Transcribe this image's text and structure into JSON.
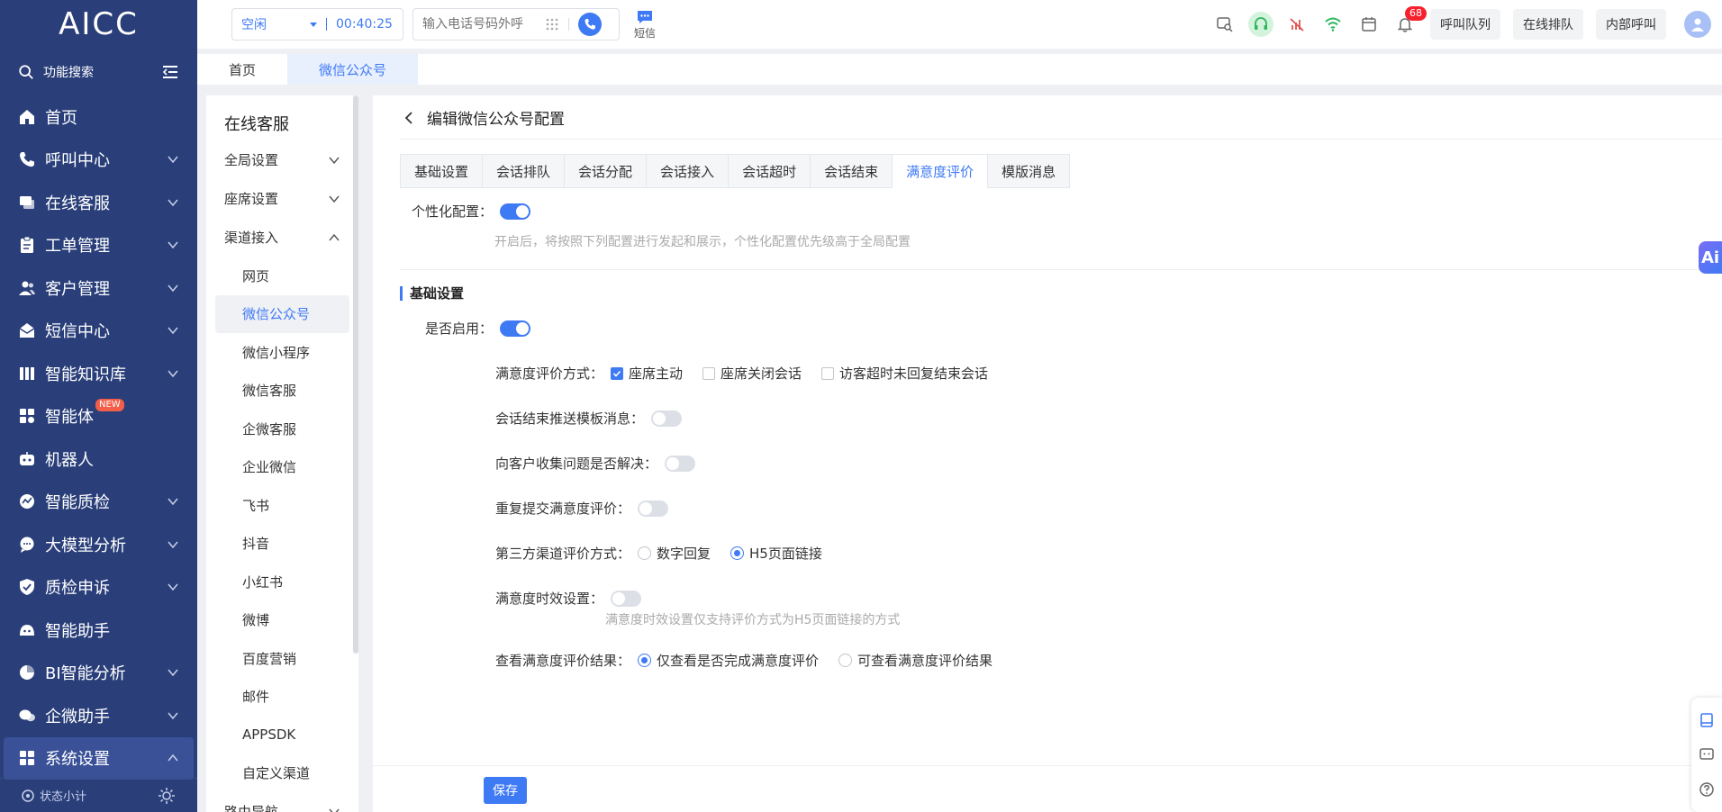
{
  "sidebar": {
    "logo": "AICC",
    "search_label": "功能搜索",
    "items": [
      {
        "label": "首页",
        "icon": "home-icon",
        "chevron": false
      },
      {
        "label": "呼叫中心",
        "icon": "phone-icon",
        "chevron": true
      },
      {
        "label": "在线客服",
        "icon": "chat-icon",
        "chevron": true
      },
      {
        "label": "工单管理",
        "icon": "clipboard-icon",
        "chevron": true
      },
      {
        "label": "客户管理",
        "icon": "users-icon",
        "chevron": true
      },
      {
        "label": "短信中心",
        "icon": "mail-icon",
        "chevron": true
      },
      {
        "label": "智能知识库",
        "icon": "book-icon",
        "chevron": true
      },
      {
        "label": "智能体",
        "icon": "apps-icon",
        "chevron": false,
        "badge": "NEW"
      },
      {
        "label": "机器人",
        "icon": "robot-icon",
        "chevron": false
      },
      {
        "label": "智能质检",
        "icon": "gauge-icon",
        "chevron": true
      },
      {
        "label": "大模型分析",
        "icon": "bubble-icon",
        "chevron": true
      },
      {
        "label": "质检申诉",
        "icon": "shield-icon",
        "chevron": true
      },
      {
        "label": "智能助手",
        "icon": "assistant-icon",
        "chevron": false
      },
      {
        "label": "BI智能分析",
        "icon": "pie-icon",
        "chevron": true
      },
      {
        "label": "企微助手",
        "icon": "wecom-icon",
        "chevron": true
      },
      {
        "label": "系统设置",
        "icon": "grid-icon",
        "chevron": true,
        "expanded": true
      }
    ],
    "footer_label": "状态小计"
  },
  "header": {
    "status": "空闲",
    "timer": "00:40:25",
    "dial_placeholder": "输入电话号码外呼",
    "sms_label": "短信",
    "bell_count": "68",
    "buttons": [
      "呼叫队列",
      "在线排队",
      "内部呼叫"
    ]
  },
  "page_tabs": [
    {
      "label": "首页",
      "active": false
    },
    {
      "label": "微信公众号",
      "active": true
    }
  ],
  "sub_menu": {
    "title": "在线客服",
    "groups": [
      {
        "label": "全局设置",
        "expanded": false
      },
      {
        "label": "座席设置",
        "expanded": false
      },
      {
        "label": "渠道接入",
        "expanded": true
      }
    ],
    "channel_items": [
      "网页",
      "微信公众号",
      "微信小程序",
      "微信客服",
      "企微客服",
      "企业微信",
      "飞书",
      "抖音",
      "小红书",
      "微博",
      "百度营销",
      "邮件",
      "APPSDK",
      "自定义渠道"
    ],
    "active_item": "微信公众号",
    "last_group": "路由导航"
  },
  "main": {
    "title": "编辑微信公众号配置",
    "tabs": [
      "基础设置",
      "会话排队",
      "会话分配",
      "会话接入",
      "会话超时",
      "会话结束",
      "满意度评价",
      "模版消息"
    ],
    "active_tab": "满意度评价",
    "personal_config_label": "个性化配置：",
    "personal_config_on": true,
    "personal_config_hint": "开启后，将按照下列配置进行发起和展示，个性化配置优先级高于全局配置",
    "section_title": "基础设置",
    "enable_label": "是否启用：",
    "enable_on": true,
    "method_label": "满意度评价方式：",
    "method_options": [
      {
        "label": "座席主动",
        "checked": true
      },
      {
        "label": "座席关闭会话",
        "checked": false
      },
      {
        "label": "访客超时未回复结束会话",
        "checked": false
      }
    ],
    "push_template_label": "会话结束推送模板消息：",
    "push_template_on": false,
    "collect_issue_label": "向客户收集问题是否解决：",
    "collect_issue_on": false,
    "repeat_submit_label": "重复提交满意度评价：",
    "repeat_submit_on": false,
    "third_party_label": "第三方渠道评价方式：",
    "third_party_options": [
      {
        "label": "数字回复",
        "selected": false
      },
      {
        "label": "H5页面链接",
        "selected": true
      }
    ],
    "timeliness_label": "满意度时效设置：",
    "timeliness_on": false,
    "timeliness_hint": "满意度时效设置仅支持评价方式为H5页面链接的方式",
    "view_result_label": "查看满意度评价结果：",
    "view_result_options": [
      {
        "label": "仅查看是否完成满意度评价",
        "selected": true
      },
      {
        "label": "可查看满意度评价结果",
        "selected": false
      }
    ],
    "save_label": "保存"
  },
  "floating": {
    "ai_label": "Ai"
  },
  "colors": {
    "sidebar_bg": "#2a3f7a",
    "accent": "#3f7af5",
    "badge_red": "#f5222d"
  }
}
